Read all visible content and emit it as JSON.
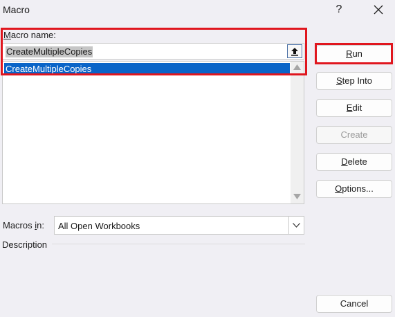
{
  "window": {
    "title": "Macro",
    "help_glyph": "?"
  },
  "macro_name": {
    "label_accel": "M",
    "label_rest": "acro name:",
    "value": "CreateMultipleCopies"
  },
  "macro_list": {
    "items": [
      "CreateMultipleCopies"
    ],
    "selected_index": 0
  },
  "buttons": {
    "run": {
      "accel": "R",
      "rest": "un"
    },
    "step_into": {
      "accel": "S",
      "rest": "tep Into"
    },
    "edit": {
      "accel": "E",
      "rest": "dit"
    },
    "create": {
      "label": "Create"
    },
    "delete": {
      "accel": "D",
      "rest": "elete"
    },
    "options": {
      "accel": "O",
      "rest": "ptions..."
    },
    "cancel": {
      "label": "Cancel"
    }
  },
  "macros_in": {
    "label_rest": "Macros ",
    "label_accel": "i",
    "label_end": "n:",
    "selected": "All Open Workbooks"
  },
  "description": {
    "label": "Description"
  },
  "colors": {
    "highlight_red": "#e0161e",
    "selection_blue": "#0a64c8"
  }
}
